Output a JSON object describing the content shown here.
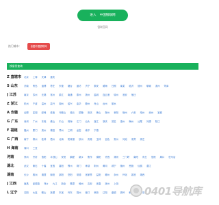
{
  "enter_button": {
    "left": "进入",
    "right": "中国银联网"
  },
  "site_link": "银联官网",
  "current": {
    "label": "热门城市：",
    "button": "该图中国银联网"
  },
  "section_title": "按省份查询",
  "provinces": [
    {
      "name": "Z 直辖市",
      "cities": [
        "北京",
        "上海",
        "天津",
        "重庆"
      ]
    },
    {
      "name": "S 山东",
      "cities": [
        "济南",
        "青岛",
        "淄博",
        "枣庄",
        "东营",
        "烟台",
        "潍坊",
        "济宁",
        "泰安",
        "威海",
        "日照",
        "莱芜",
        "临沂",
        "德州",
        "聊城",
        "滨州",
        "菏泽"
      ]
    },
    {
      "name": "J 江苏",
      "cities": [
        "南京",
        "苏州",
        "无锡",
        "常州",
        "镇江",
        "南通",
        "泰州",
        "扬州",
        "盐城",
        "连云港",
        "徐州",
        "淮安",
        "宿迁"
      ]
    },
    {
      "name": "Z 浙江",
      "cities": [
        "杭州",
        "宁波",
        "温州",
        "嘉兴",
        "湖州",
        "绍兴",
        "金华",
        "衢州",
        "舟山",
        "台州",
        "丽水"
      ]
    },
    {
      "name": "A 安徽",
      "cities": [
        "合肥",
        "芜湖",
        "蚌埠",
        "淮南",
        "马鞍山",
        "淮北",
        "铜陵",
        "安庆",
        "黄山",
        "滁州",
        "阜阳",
        "宿州",
        "六安",
        "亳州",
        "池州",
        "宣城"
      ]
    },
    {
      "name": "G 广东",
      "cities": [
        "深圳",
        "广州",
        "东莞",
        "佛山",
        "中山",
        "珠海",
        "江门",
        "汕头",
        "湛江",
        "肇庆",
        "茂名",
        "惠州",
        "梅州",
        "汕尾",
        "河源",
        "阳江"
      ]
    },
    {
      "name": "F 福建",
      "cities": [
        "福州",
        "厦门",
        "泉州",
        "莆田",
        "漳州",
        "三明",
        "龙岩",
        "南平",
        "宁德"
      ]
    },
    {
      "name": "G 广西",
      "cities": [
        "南宁",
        "柳州",
        "桂林",
        "梧州",
        "北海",
        "防城港",
        "钦州",
        "贵港",
        "玉林",
        "百色",
        "贺州",
        "河池",
        "来宾",
        "崇左"
      ]
    },
    {
      "name": "H 海南",
      "cities": [
        "海口",
        "三亚"
      ]
    },
    {
      "name": "河南",
      "cities": [
        "郑州",
        "开封",
        "洛阳",
        "平顶山",
        "安阳",
        "鹤壁",
        "新乡",
        "焦作",
        "濮阳",
        "许昌",
        "漯河",
        "三门峡",
        "南阳",
        "商丘",
        "信阳",
        "周口",
        "驻马店"
      ]
    },
    {
      "name": "湖北",
      "cities": [
        "武汉",
        "黄石",
        "十堰",
        "宜昌",
        "襄阳",
        "鄂州",
        "荆门",
        "孝感",
        "荆州",
        "黄冈",
        "咸宁",
        "随州",
        "恩施",
        "仙桃",
        "潜江"
      ]
    },
    {
      "name": "湖南",
      "cities": [
        "长沙",
        "株洲",
        "湘潭",
        "衡阳",
        "邵阳",
        "岳阳",
        "常德",
        "张家界",
        "益阳",
        "郴州",
        "永州",
        "怀化",
        "娄底",
        "湘西"
      ]
    },
    {
      "name": "J 江西",
      "cities": [
        "南昌",
        "景德镇",
        "萍乡",
        "九江",
        "新余",
        "鹰潭",
        "赣州",
        "吉安",
        "宜春",
        "抚州",
        "上饶"
      ]
    },
    {
      "name": "L 辽宁",
      "cities": [
        "沈阳",
        "大连",
        "鞍山",
        "抚顺",
        "本溪",
        "丹东",
        "锦州",
        "营口",
        "阜新",
        "辽阳",
        "盘锦",
        "铁岭",
        "朝阳",
        "葫芦岛"
      ]
    }
  ],
  "watermark": "0401导航库",
  "colors": {
    "accent": "#19b15c",
    "current_button": "#e54b4b",
    "city_link": "#3a7bd5"
  }
}
